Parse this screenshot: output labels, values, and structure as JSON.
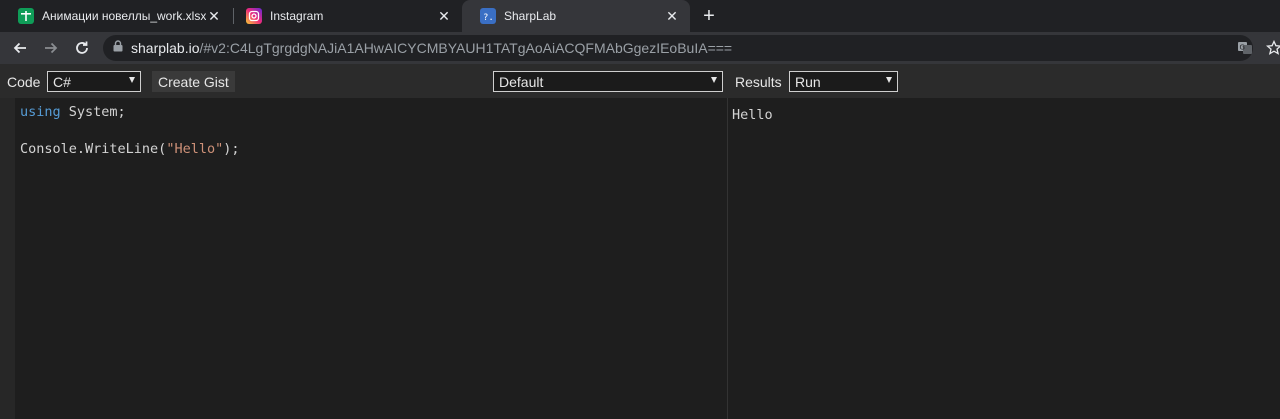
{
  "browser": {
    "tabs": [
      {
        "title": "Анимации новеллы_work.xlsx - Google",
        "icon": "sheets-icon",
        "active": false
      },
      {
        "title": "Instagram",
        "icon": "instagram-icon",
        "active": false
      },
      {
        "title": "SharpLab",
        "icon": "sharplab-icon",
        "active": true
      }
    ],
    "new_tab_glyph": "+",
    "address": {
      "host": "sharplab.io",
      "rest": "/#v2:C4LgTgrgdgNAJiA1AHwAICYCMBYAUH1TATgAoAiACQFMAbGgezIEoBuIA==="
    }
  },
  "sharplab": {
    "code_label": "Code",
    "language": "C#",
    "create_gist_label": "Create Gist",
    "branch": "Default",
    "results_label": "Results",
    "mode": "Run",
    "code_lines": [
      {
        "keyword": "using",
        "text": " System;"
      },
      {
        "text": ""
      },
      {
        "text": "Console.WriteLine(",
        "string": "\"Hello\"",
        "after": ");"
      }
    ],
    "output": "Hello"
  },
  "colors": {
    "tabstrip": "#202124",
    "active_tab": "#35363a",
    "keyword": "#569cd6",
    "string": "#ce9178",
    "text": "#d4d4d4"
  }
}
